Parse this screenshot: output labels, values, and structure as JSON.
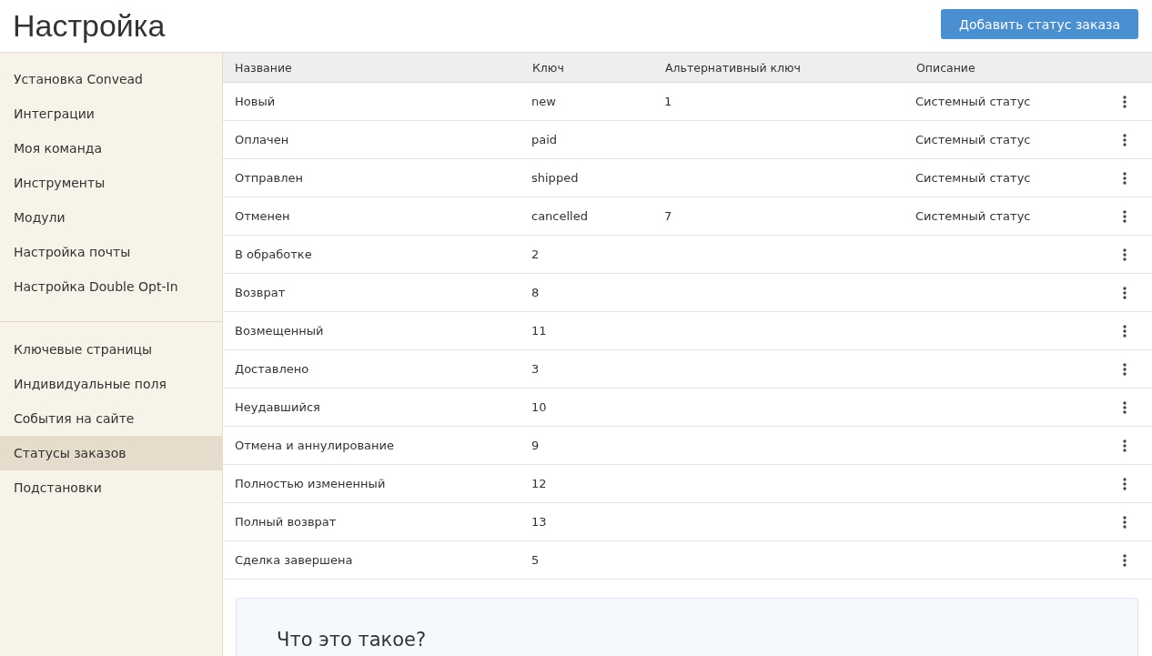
{
  "header": {
    "title": "Настройка",
    "add_button": "Добавить статус заказа"
  },
  "sidebar": {
    "groups": [
      {
        "items": [
          {
            "label": "Установка Convead",
            "selected": false
          },
          {
            "label": "Интеграции",
            "selected": false
          },
          {
            "label": "Моя команда",
            "selected": false
          },
          {
            "label": "Инструменты",
            "selected": false
          },
          {
            "label": "Модули",
            "selected": false
          },
          {
            "label": "Настройка почты",
            "selected": false
          },
          {
            "label": "Настройка Double Opt-In",
            "selected": false
          }
        ]
      },
      {
        "items": [
          {
            "label": "Ключевые страницы",
            "selected": false
          },
          {
            "label": "Индивидуальные поля",
            "selected": false
          },
          {
            "label": "События на сайте",
            "selected": false
          },
          {
            "label": "Статусы заказов",
            "selected": true
          },
          {
            "label": "Подстановки",
            "selected": false
          }
        ]
      }
    ]
  },
  "table": {
    "columns": [
      "Название",
      "Ключ",
      "Альтернативный ключ",
      "Описание"
    ],
    "rows": [
      [
        "Новый",
        "new",
        "1",
        "Системный статус"
      ],
      [
        "Оплачен",
        "paid",
        "",
        "Системный статус"
      ],
      [
        "Отправлен",
        "shipped",
        "",
        "Системный статус"
      ],
      [
        "Отменен",
        "cancelled",
        "7",
        "Системный статус"
      ],
      [
        "В обработке",
        "2",
        "",
        ""
      ],
      [
        "Возврат",
        "8",
        "",
        ""
      ],
      [
        "Возмещенный",
        "11",
        "",
        ""
      ],
      [
        "Доставлено",
        "3",
        "",
        ""
      ],
      [
        "Неудавшийся",
        "10",
        "",
        ""
      ],
      [
        "Отмена и аннулирование",
        "9",
        "",
        ""
      ],
      [
        "Полностью измененный",
        "12",
        "",
        ""
      ],
      [
        "Полный возврат",
        "13",
        "",
        ""
      ],
      [
        "Сделка завершена",
        "5",
        "",
        ""
      ]
    ]
  },
  "info": {
    "title": "Что это такое?"
  }
}
